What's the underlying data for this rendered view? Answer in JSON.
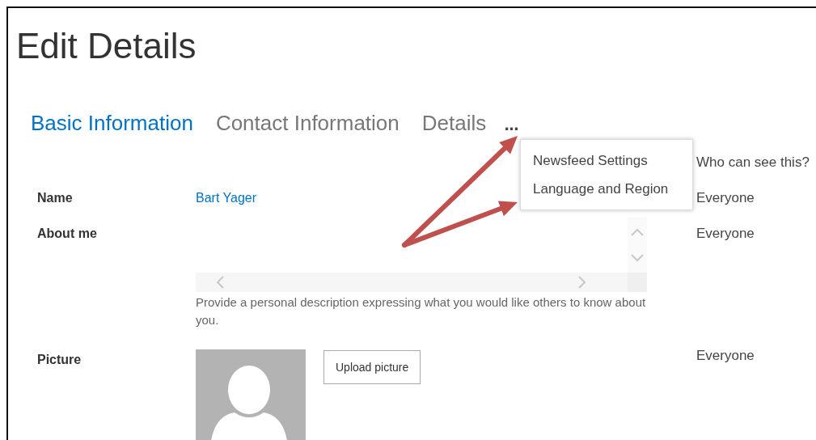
{
  "page": {
    "title": "Edit Details"
  },
  "tabs": [
    {
      "label": "Basic Information",
      "selected": true
    },
    {
      "label": "Contact Information",
      "selected": false
    },
    {
      "label": "Details",
      "selected": false
    }
  ],
  "more_button": {
    "label": "..."
  },
  "menu": {
    "items": [
      {
        "label": "Newsfeed Settings"
      },
      {
        "label": "Language and Region"
      }
    ]
  },
  "visibility_header": "Who can see this?",
  "fields": [
    {
      "kind": "text",
      "label": "Name",
      "value": "Bart Yager",
      "visibility": "Everyone"
    },
    {
      "kind": "textarea",
      "label": "About me",
      "hint": "Provide a personal description expressing what you would like others to know about you.",
      "visibility": "Everyone"
    },
    {
      "kind": "picture",
      "label": "Picture",
      "button": "Upload picture",
      "visibility": "Everyone"
    }
  ]
}
